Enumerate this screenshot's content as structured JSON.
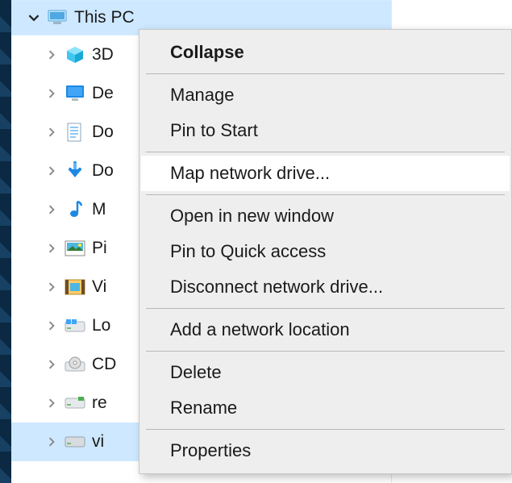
{
  "tree": {
    "root": {
      "label": "This PC"
    },
    "items": [
      {
        "label": "3D"
      },
      {
        "label": "De"
      },
      {
        "label": "Do"
      },
      {
        "label": "Do"
      },
      {
        "label": "M"
      },
      {
        "label": "Pi"
      },
      {
        "label": "Vi"
      },
      {
        "label": "Lo"
      },
      {
        "label": "CD"
      },
      {
        "label": "re"
      },
      {
        "label": "vi"
      }
    ]
  },
  "context_menu": {
    "groups": [
      [
        {
          "label": "Collapse",
          "bold": true
        }
      ],
      [
        {
          "label": "Manage"
        },
        {
          "label": "Pin to Start"
        }
      ],
      [
        {
          "label": "Map network drive...",
          "hover": true
        }
      ],
      [
        {
          "label": "Open in new window"
        },
        {
          "label": "Pin to Quick access"
        },
        {
          "label": "Disconnect network drive..."
        }
      ],
      [
        {
          "label": "Add a network location"
        }
      ],
      [
        {
          "label": "Delete"
        },
        {
          "label": "Rename"
        }
      ],
      [
        {
          "label": "Properties"
        }
      ]
    ]
  }
}
